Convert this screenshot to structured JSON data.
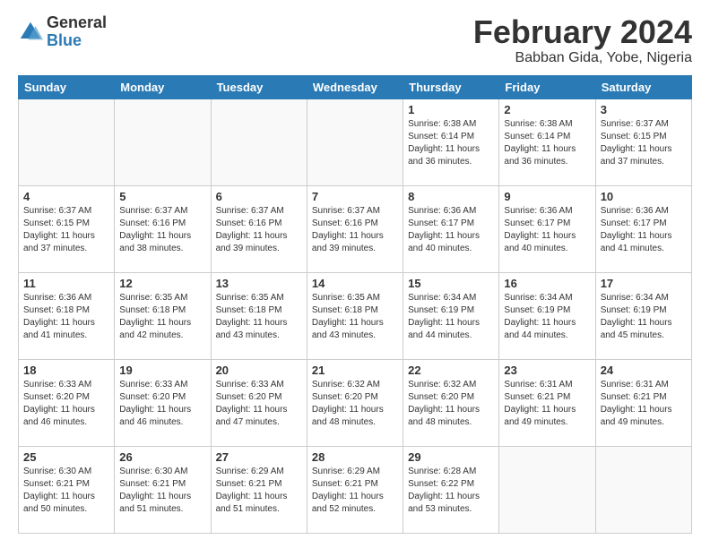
{
  "logo": {
    "general": "General",
    "blue": "Blue"
  },
  "header": {
    "month": "February 2024",
    "location": "Babban Gida, Yobe, Nigeria"
  },
  "weekdays": [
    "Sunday",
    "Monday",
    "Tuesday",
    "Wednesday",
    "Thursday",
    "Friday",
    "Saturday"
  ],
  "weeks": [
    [
      {
        "day": "",
        "info": ""
      },
      {
        "day": "",
        "info": ""
      },
      {
        "day": "",
        "info": ""
      },
      {
        "day": "",
        "info": ""
      },
      {
        "day": "1",
        "info": "Sunrise: 6:38 AM\nSunset: 6:14 PM\nDaylight: 11 hours and 36 minutes."
      },
      {
        "day": "2",
        "info": "Sunrise: 6:38 AM\nSunset: 6:14 PM\nDaylight: 11 hours and 36 minutes."
      },
      {
        "day": "3",
        "info": "Sunrise: 6:37 AM\nSunset: 6:15 PM\nDaylight: 11 hours and 37 minutes."
      }
    ],
    [
      {
        "day": "4",
        "info": "Sunrise: 6:37 AM\nSunset: 6:15 PM\nDaylight: 11 hours and 37 minutes."
      },
      {
        "day": "5",
        "info": "Sunrise: 6:37 AM\nSunset: 6:16 PM\nDaylight: 11 hours and 38 minutes."
      },
      {
        "day": "6",
        "info": "Sunrise: 6:37 AM\nSunset: 6:16 PM\nDaylight: 11 hours and 39 minutes."
      },
      {
        "day": "7",
        "info": "Sunrise: 6:37 AM\nSunset: 6:16 PM\nDaylight: 11 hours and 39 minutes."
      },
      {
        "day": "8",
        "info": "Sunrise: 6:36 AM\nSunset: 6:17 PM\nDaylight: 11 hours and 40 minutes."
      },
      {
        "day": "9",
        "info": "Sunrise: 6:36 AM\nSunset: 6:17 PM\nDaylight: 11 hours and 40 minutes."
      },
      {
        "day": "10",
        "info": "Sunrise: 6:36 AM\nSunset: 6:17 PM\nDaylight: 11 hours and 41 minutes."
      }
    ],
    [
      {
        "day": "11",
        "info": "Sunrise: 6:36 AM\nSunset: 6:18 PM\nDaylight: 11 hours and 41 minutes."
      },
      {
        "day": "12",
        "info": "Sunrise: 6:35 AM\nSunset: 6:18 PM\nDaylight: 11 hours and 42 minutes."
      },
      {
        "day": "13",
        "info": "Sunrise: 6:35 AM\nSunset: 6:18 PM\nDaylight: 11 hours and 43 minutes."
      },
      {
        "day": "14",
        "info": "Sunrise: 6:35 AM\nSunset: 6:18 PM\nDaylight: 11 hours and 43 minutes."
      },
      {
        "day": "15",
        "info": "Sunrise: 6:34 AM\nSunset: 6:19 PM\nDaylight: 11 hours and 44 minutes."
      },
      {
        "day": "16",
        "info": "Sunrise: 6:34 AM\nSunset: 6:19 PM\nDaylight: 11 hours and 44 minutes."
      },
      {
        "day": "17",
        "info": "Sunrise: 6:34 AM\nSunset: 6:19 PM\nDaylight: 11 hours and 45 minutes."
      }
    ],
    [
      {
        "day": "18",
        "info": "Sunrise: 6:33 AM\nSunset: 6:20 PM\nDaylight: 11 hours and 46 minutes."
      },
      {
        "day": "19",
        "info": "Sunrise: 6:33 AM\nSunset: 6:20 PM\nDaylight: 11 hours and 46 minutes."
      },
      {
        "day": "20",
        "info": "Sunrise: 6:33 AM\nSunset: 6:20 PM\nDaylight: 11 hours and 47 minutes."
      },
      {
        "day": "21",
        "info": "Sunrise: 6:32 AM\nSunset: 6:20 PM\nDaylight: 11 hours and 48 minutes."
      },
      {
        "day": "22",
        "info": "Sunrise: 6:32 AM\nSunset: 6:20 PM\nDaylight: 11 hours and 48 minutes."
      },
      {
        "day": "23",
        "info": "Sunrise: 6:31 AM\nSunset: 6:21 PM\nDaylight: 11 hours and 49 minutes."
      },
      {
        "day": "24",
        "info": "Sunrise: 6:31 AM\nSunset: 6:21 PM\nDaylight: 11 hours and 49 minutes."
      }
    ],
    [
      {
        "day": "25",
        "info": "Sunrise: 6:30 AM\nSunset: 6:21 PM\nDaylight: 11 hours and 50 minutes."
      },
      {
        "day": "26",
        "info": "Sunrise: 6:30 AM\nSunset: 6:21 PM\nDaylight: 11 hours and 51 minutes."
      },
      {
        "day": "27",
        "info": "Sunrise: 6:29 AM\nSunset: 6:21 PM\nDaylight: 11 hours and 51 minutes."
      },
      {
        "day": "28",
        "info": "Sunrise: 6:29 AM\nSunset: 6:21 PM\nDaylight: 11 hours and 52 minutes."
      },
      {
        "day": "29",
        "info": "Sunrise: 6:28 AM\nSunset: 6:22 PM\nDaylight: 11 hours and 53 minutes."
      },
      {
        "day": "",
        "info": ""
      },
      {
        "day": "",
        "info": ""
      }
    ]
  ]
}
